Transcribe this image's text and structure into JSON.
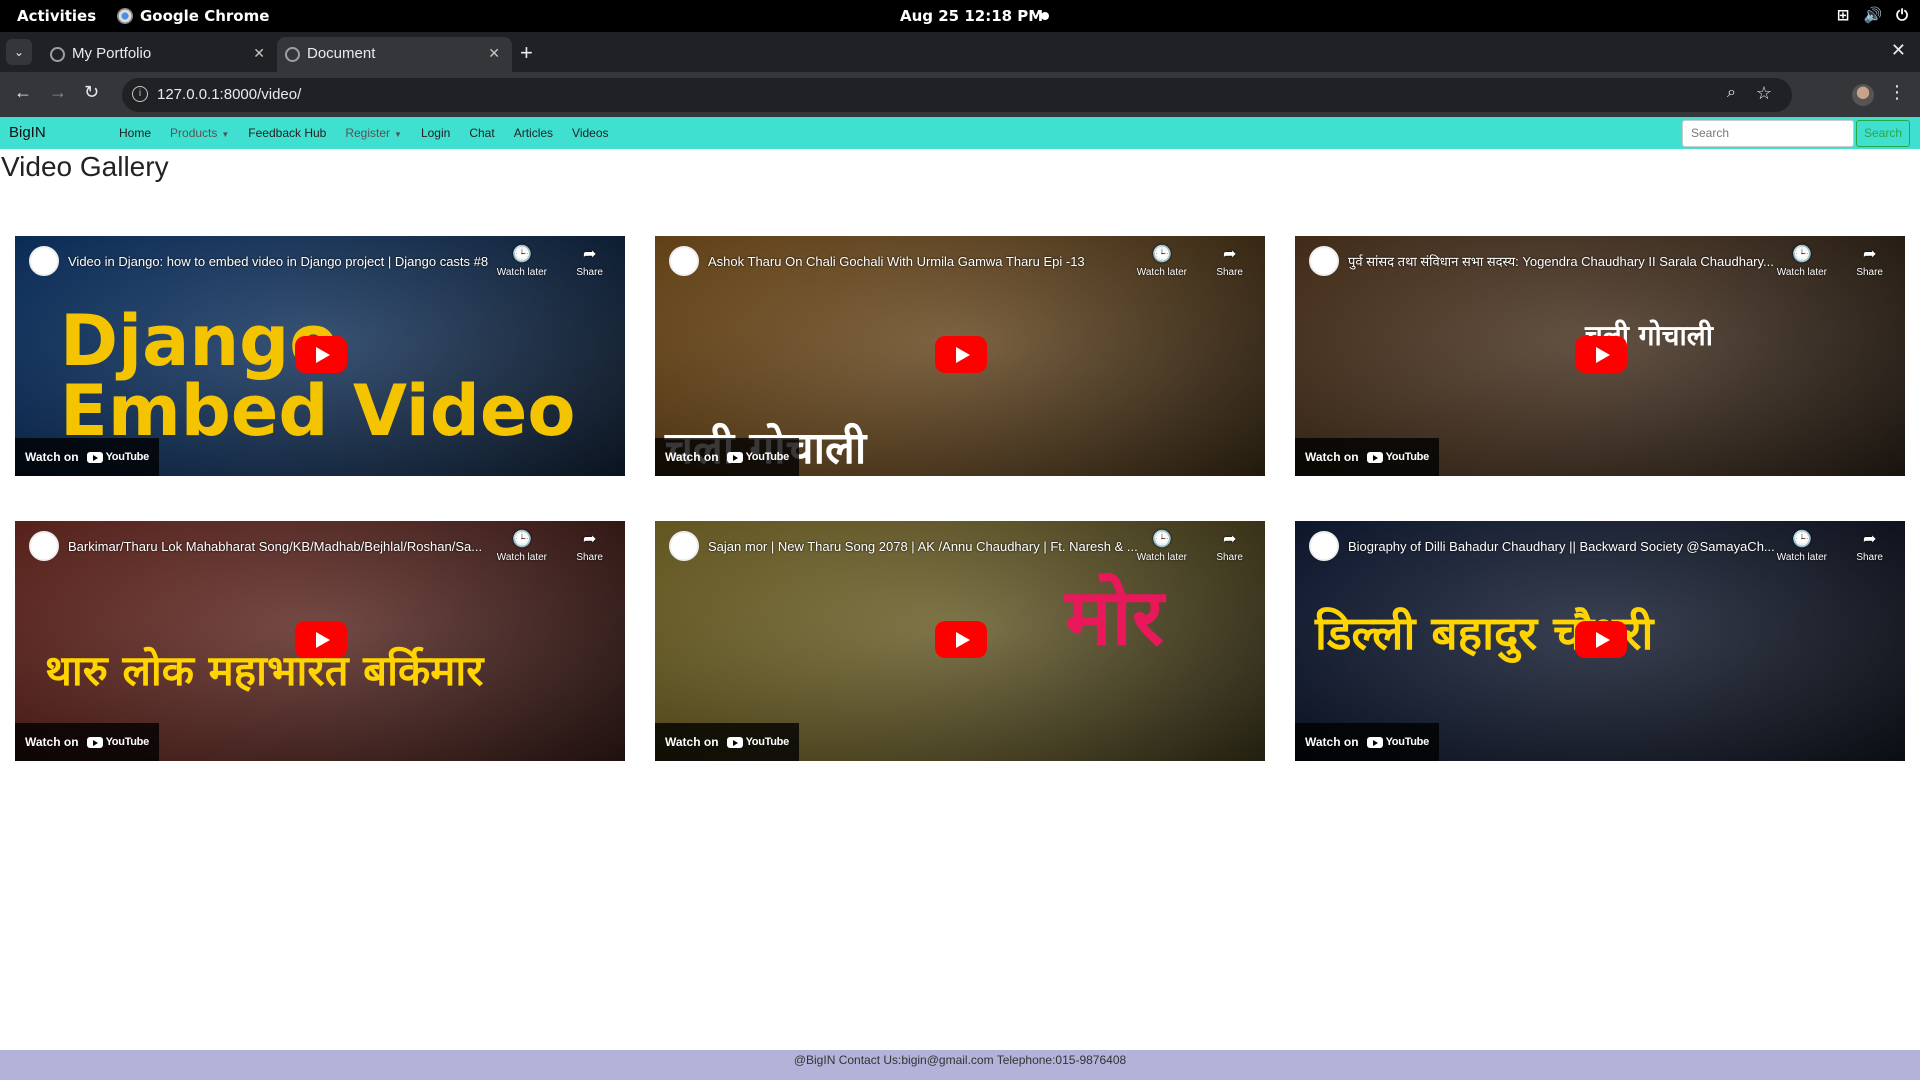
{
  "os": {
    "activities": "Activities",
    "app_name": "Google Chrome",
    "clock": "Aug 25  12:18 PM"
  },
  "browser": {
    "tabs": [
      {
        "title": "My Portfolio",
        "active": false
      },
      {
        "title": "Document",
        "active": true
      }
    ],
    "url": "127.0.0.1:8000/video/"
  },
  "nav": {
    "brand": "BigIN",
    "links": [
      "Home",
      "Products",
      "Feedback Hub",
      "Register",
      "Login",
      "Chat",
      "Articles",
      "Videos"
    ],
    "search_placeholder": "Search",
    "search_button": "Search"
  },
  "page": {
    "title": "Video Gallery"
  },
  "videos": [
    {
      "title": "Video in Django: how to embed video in Django project | Django casts #8",
      "watch_later": "Watch later",
      "share": "Share",
      "watch_on": "Watch on",
      "yt": "YouTube",
      "thumb_text": "Django Embed Video",
      "color": "#0a3b7a"
    },
    {
      "title": "Ashok Tharu On Chali Gochali With Urmila Gamwa Tharu Epi -13",
      "watch_later": "Watch later",
      "share": "Share",
      "watch_on": "Watch on",
      "yt": "YouTube",
      "thumb_text": "चली गोचाली",
      "color": "#8a5a1c"
    },
    {
      "title": "पुर्व सांसद तथा संविधान सभा सदस्य: Yogendra Chaudhary II Sarala Chaudhary...",
      "watch_later": "Watch later",
      "share": "Share",
      "watch_on": "Watch on",
      "yt": "YouTube",
      "thumb_text": "चली गोचाली",
      "color": "#5a3a1e"
    },
    {
      "title": "Barkimar/Tharu Lok Mahabharat Song/KB/Madhab/Bejhlal/Roshan/Sa...",
      "watch_later": "Watch later",
      "share": "Share",
      "watch_on": "Watch on",
      "yt": "YouTube",
      "thumb_text": "थारु लोक महाभारत बर्किमार",
      "color": "#7a2b22"
    },
    {
      "title": "Sajan mor | New Tharu Song 2078 | AK /Annu Chaudhary | Ft. Naresh & ...",
      "watch_later": "Watch later",
      "share": "Share",
      "watch_on": "Watch on",
      "yt": "YouTube",
      "thumb_text": "मोर",
      "color": "#8c7a2a"
    },
    {
      "title": "Biography of Dilli Bahadur Chaudhary || Backward Society @SamayaCh...",
      "watch_later": "Watch later",
      "share": "Share",
      "watch_on": "Watch on",
      "yt": "YouTube",
      "thumb_text": "डिल्ली बहादुर चौधरी",
      "color": "#0d1a3a"
    }
  ],
  "footer": "@BigIN Contact Us:bigin@gmail.com Telephone:015-9876408"
}
